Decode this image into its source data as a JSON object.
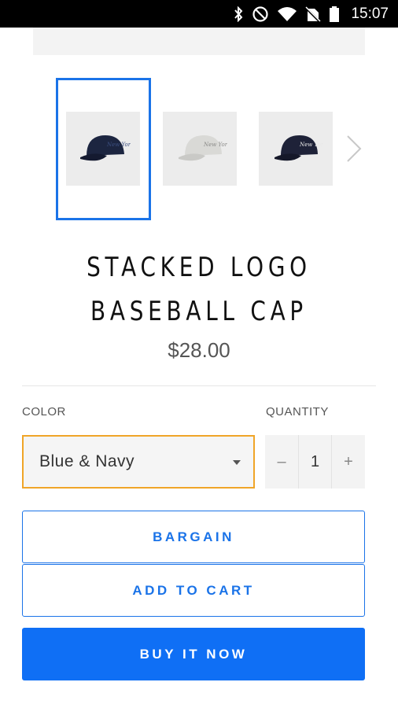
{
  "status_bar": {
    "time": "15:07",
    "icons": [
      "bluetooth-icon",
      "do-not-disturb-icon",
      "wifi-icon",
      "no-sim-icon",
      "battery-icon"
    ]
  },
  "gallery": {
    "thumbnails": [
      {
        "name": "navy-cap-thumbnail",
        "selected": true,
        "cap_color": "#1c2540",
        "logo_color": "#3c4f80"
      },
      {
        "name": "white-cap-thumbnail",
        "selected": false,
        "cap_color": "#d9d9d6",
        "logo_color": "#8a8a88"
      },
      {
        "name": "navy-white-logo-cap-thumbnail",
        "selected": false,
        "cap_color": "#1e2238",
        "logo_color": "#e8e8e8"
      }
    ],
    "next_icon": "chevron-right-icon"
  },
  "product": {
    "title_line1": "STACKED LOGO",
    "title_line2": "BASEBALL CAP",
    "price": "$28.00"
  },
  "options": {
    "color_label": "COLOR",
    "color_value": "Blue & Navy",
    "quantity_label": "QUANTITY",
    "quantity_value": "1",
    "decrement_symbol": "–",
    "increment_symbol": "+"
  },
  "actions": {
    "bargain_label": "BARGAIN",
    "add_to_cart_label": "ADD TO CART",
    "buy_now_label": "BUY IT NOW"
  },
  "colors": {
    "accent": "#1a73e8",
    "buy_button": "#0f6ff5",
    "select_border": "#f0a528"
  }
}
